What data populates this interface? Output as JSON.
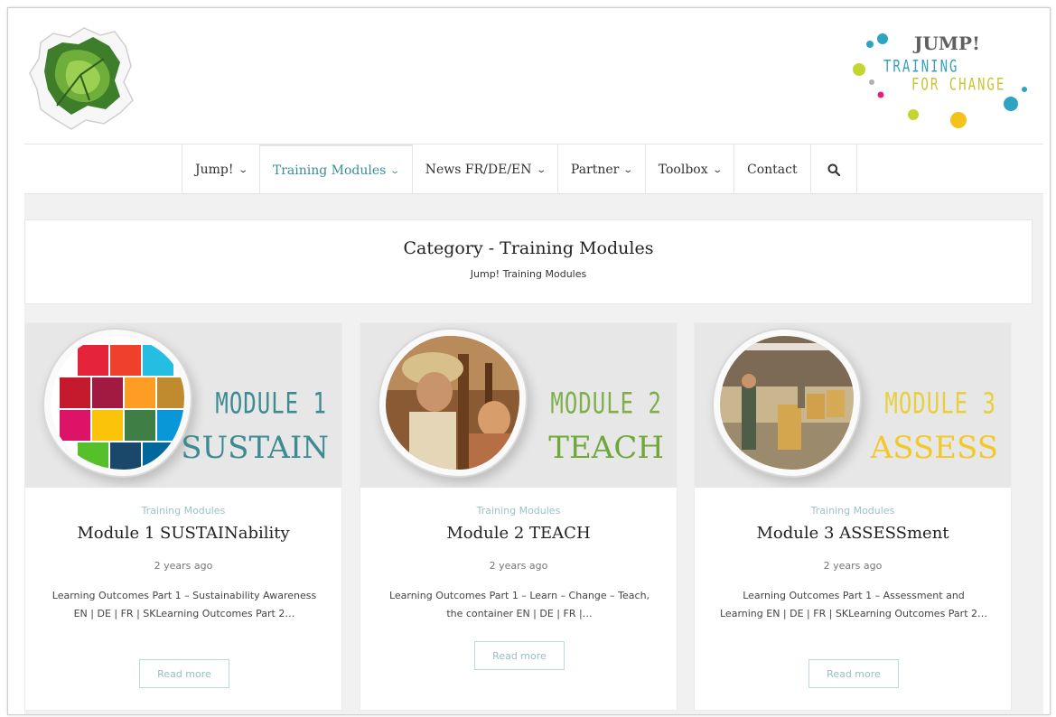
{
  "brand": {
    "title": "JUMP!",
    "line1": "TRAINING",
    "line2": "FOR CHANGE"
  },
  "nav": {
    "items": [
      {
        "label": "Jump!",
        "has_dropdown": true
      },
      {
        "label": "Training Modules",
        "has_dropdown": true,
        "active": true
      },
      {
        "label": "News FR/DE/EN",
        "has_dropdown": true
      },
      {
        "label": "Partner",
        "has_dropdown": true
      },
      {
        "label": "Toolbox",
        "has_dropdown": true
      },
      {
        "label": "Contact",
        "has_dropdown": false
      }
    ],
    "search_icon": "search-icon",
    "active_color": "#3a8e95"
  },
  "category": {
    "title": "Category - Training Modules",
    "subtitle": "Jump! Training Modules"
  },
  "cards": [
    {
      "module_number": "MODULE 1",
      "module_word": "SUSTAIN",
      "number_color": "#3d8b91",
      "word_color": "#3d8b91",
      "category": "Training Modules",
      "title": "Module 1 SUSTAINability",
      "date": "2 years ago",
      "excerpt": "Learning Outcomes Part 1 – Sustainability Awareness EN | DE | FR | SKLearning Outcomes Part 2…",
      "read_more": "Read more"
    },
    {
      "module_number": "MODULE 2",
      "module_word": "TEACH",
      "number_color": "#7eaf48",
      "word_color": "#6fa83a",
      "category": "Training Modules",
      "title": "Module 2 TEACH",
      "date": "2 years ago",
      "excerpt": "Learning Outcomes Part 1 – Learn – Change – Teach, the container EN | DE | FR |…",
      "read_more": "Read more"
    },
    {
      "module_number": "MODULE 3",
      "module_word": "ASSESS",
      "number_color": "#e8cf3c",
      "word_color": "#f1c92a",
      "category": "Training Modules",
      "title": "Module 3 ASSESSment",
      "date": "2 years ago",
      "excerpt": "Learning Outcomes Part 1 – Assessment and Learning EN | DE | FR | SKLearning Outcomes Part 2…",
      "read_more": "Read more"
    }
  ]
}
